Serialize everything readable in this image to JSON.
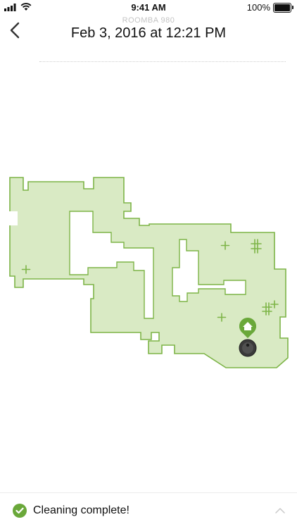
{
  "status_bar": {
    "time": "9:41 AM",
    "battery_text": "100%",
    "battery_level": 1.0,
    "icons": [
      "cellular-signal-icon",
      "wifi-icon",
      "battery-icon"
    ]
  },
  "header": {
    "subtitle": "ROOMBA 980",
    "title": "Feb 3, 2016 at 12:21 PM",
    "back_icon": "chevron-left-icon"
  },
  "map": {
    "fill_color": "#d9eac4",
    "outline_color": "#7db447",
    "marker_color": "#7db447",
    "dirt_markers_count": 7,
    "home_icon": "home-base-icon",
    "robot_icon": "robot-icon"
  },
  "footer": {
    "status_label": "Cleaning complete!",
    "status_icon": "check-circle-icon",
    "status_color": "#6aa83a",
    "expand_icon": "chevron-up-icon"
  }
}
